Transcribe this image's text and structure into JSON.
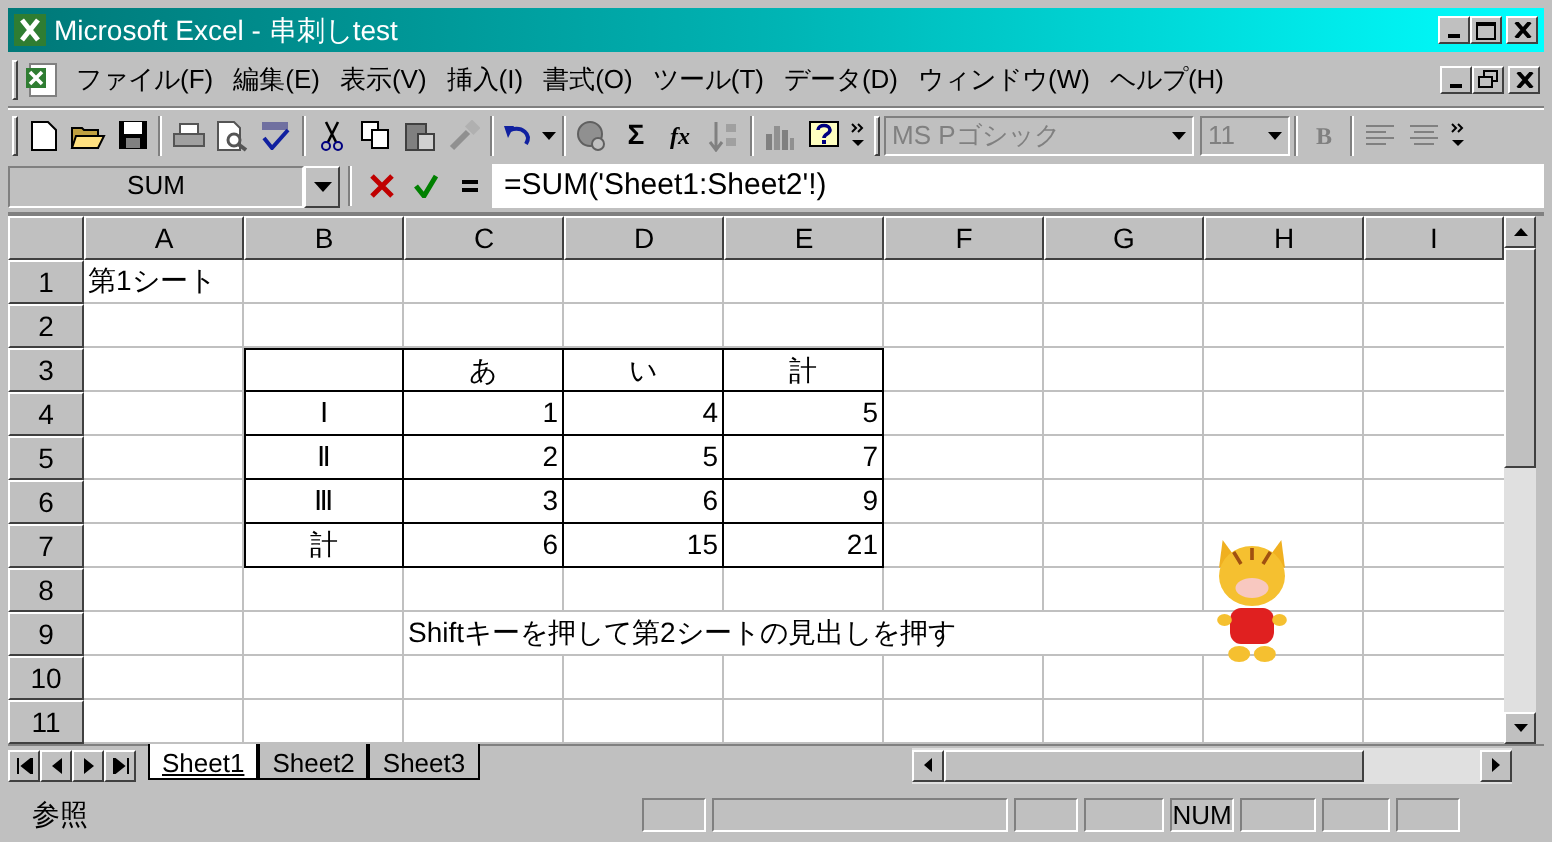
{
  "window": {
    "title": "Microsoft Excel - 串刺しtest"
  },
  "menu": [
    {
      "label": "ファイル(F)"
    },
    {
      "label": "編集(E)"
    },
    {
      "label": "表示(V)"
    },
    {
      "label": "挿入(I)"
    },
    {
      "label": "書式(O)"
    },
    {
      "label": "ツール(T)"
    },
    {
      "label": "データ(D)"
    },
    {
      "label": "ウィンドウ(W)"
    },
    {
      "label": "ヘルプ(H)"
    }
  ],
  "toolbar": {
    "sum_glyph": "Σ",
    "function_glyph": "fx",
    "font": "MS Pゴシック",
    "size": "11",
    "bold_glyph": "B"
  },
  "formula_bar": {
    "name_box": "SUM",
    "formula": "=SUM('Sheet1:Sheet2'!)"
  },
  "columns": [
    "A",
    "B",
    "C",
    "D",
    "E",
    "F",
    "G",
    "H",
    "I"
  ],
  "row_headers": [
    "1",
    "2",
    "3",
    "4",
    "5",
    "6",
    "7",
    "8",
    "9",
    "10",
    "11"
  ],
  "sheet_title": "第1シート",
  "table": {
    "columns": [
      "あ",
      "い",
      "計"
    ],
    "rows": [
      {
        "label": "Ⅰ",
        "values": [
          "1",
          "4",
          "5"
        ]
      },
      {
        "label": "Ⅱ",
        "values": [
          "2",
          "5",
          "7"
        ]
      },
      {
        "label": "Ⅲ",
        "values": [
          "3",
          "6",
          "9"
        ]
      },
      {
        "label": "計",
        "values": [
          "6",
          "15",
          "21"
        ]
      }
    ]
  },
  "instruction": "Shiftキーを押して第2シートの見出しを押す",
  "sheet_tabs": [
    {
      "label": "Sheet1",
      "selected": true
    },
    {
      "label": "Sheet2",
      "selected": false
    },
    {
      "label": "Sheet3",
      "selected": false
    }
  ],
  "status_bar": {
    "mode": "参照",
    "num_lock": "NUM"
  }
}
